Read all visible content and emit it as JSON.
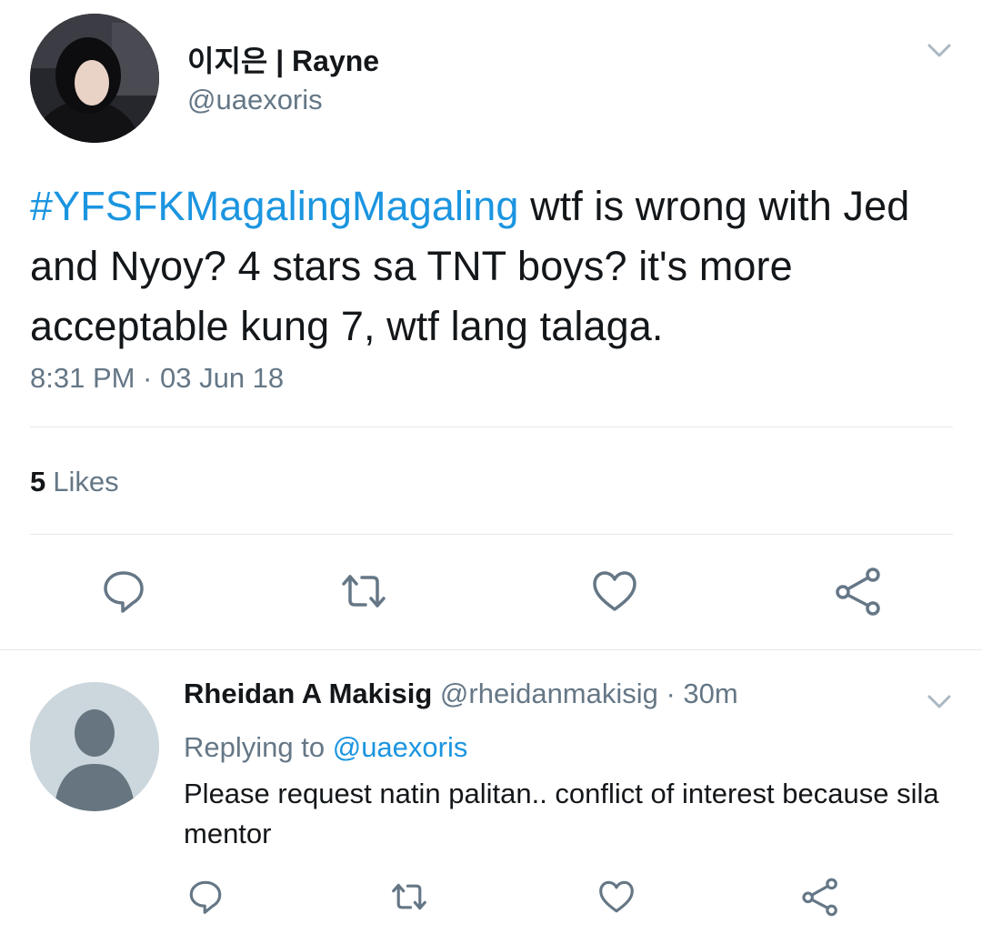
{
  "main_tweet": {
    "author_name": "이지은 | Rayne",
    "author_handle": "@uaexoris",
    "hashtag": "#YFSFKMagalingMagaling",
    "text": " wtf is wrong with Jed and Nyoy? 4 stars sa TNT boys? it's more acceptable kung 7, wtf lang talaga.",
    "timestamp": "8:31 PM · 03 Jun 18",
    "likes_count": "5",
    "likes_label": "Likes"
  },
  "reply_tweet": {
    "author_name": "Rheidan A Makisig",
    "author_handle_time": " @rheidanmakisig · 30m",
    "replying_prefix": "Replying to ",
    "replying_handle": "@uaexoris",
    "text": "Please request natin palitan.. conflict of interest because sila mentor"
  },
  "icons": {
    "menu": "chevron-down-icon",
    "reply": "reply-icon",
    "retweet": "retweet-icon",
    "like": "heart-icon",
    "share": "share-icon"
  },
  "colors": {
    "link": "#1b95e0",
    "secondary_text": "#657786",
    "primary_text": "#14171a",
    "divider": "#e1e8ed"
  }
}
